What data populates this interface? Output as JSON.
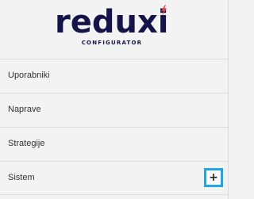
{
  "logo": {
    "wordmark": "reduxi",
    "subtitle": "CONFIGURATOR",
    "icon": "lightning-bolt-icon",
    "color": "#14134a",
    "accent_color": "#e8423c"
  },
  "menu": {
    "items": [
      {
        "label": "Uporabniki"
      },
      {
        "label": "Naprave"
      },
      {
        "label": "Strategije"
      },
      {
        "label": "Sistem",
        "expand_icon": "plus-icon",
        "expand_symbol": "+"
      }
    ]
  },
  "colors": {
    "background": "#f3f3f3",
    "divider": "#dcdcdc",
    "focus_outline": "#1ea6e6"
  }
}
